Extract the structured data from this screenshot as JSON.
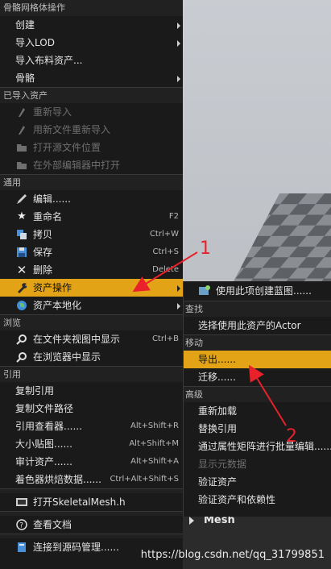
{
  "main_menu": {
    "sections": [
      {
        "header": "骨骼网格体操作",
        "items": [
          {
            "label": "创建",
            "submenu": true
          },
          {
            "label": "导入LOD",
            "submenu": true
          },
          {
            "label": "导入布料资产...",
            "submenu": false
          },
          {
            "label": "骨骼",
            "submenu": true
          }
        ]
      },
      {
        "header": "已导入资产",
        "items": [
          {
            "label": "重新导入",
            "icon": "reimport-icon",
            "disabled": true
          },
          {
            "label": "用新文件重新导入",
            "icon": "reimport-new-file-icon",
            "disabled": true
          },
          {
            "label": "打开源文件位置",
            "icon": "folder-icon",
            "disabled": true
          },
          {
            "label": "在外部编辑器中打开",
            "icon": "external-editor-icon",
            "disabled": true
          }
        ]
      },
      {
        "header": "通用",
        "items": [
          {
            "label": "编辑......",
            "icon": "edit-icon"
          },
          {
            "label": "重命名",
            "icon": "rename-icon",
            "shortcut": "F2"
          },
          {
            "label": "拷贝",
            "icon": "duplicate-icon",
            "shortcut": "Ctrl+W"
          },
          {
            "label": "保存",
            "icon": "save-icon",
            "shortcut": "Ctrl+S"
          },
          {
            "label": "删除",
            "icon": "delete-icon",
            "shortcut": "Delete"
          },
          {
            "label": "资产操作",
            "icon": "wrench-icon",
            "submenu": true,
            "highlighted": true
          },
          {
            "label": "资产本地化",
            "icon": "globe-icon",
            "submenu": true
          }
        ]
      },
      {
        "header": "浏览",
        "items": [
          {
            "label": "在文件夹视图中显示",
            "icon": "magnifier-icon",
            "shortcut": "Ctrl+B"
          },
          {
            "label": "在浏览器中显示",
            "icon": "magnifier-icon"
          }
        ]
      },
      {
        "header": "引用",
        "items": [
          {
            "label": "复制引用"
          },
          {
            "label": "复制文件路径"
          },
          {
            "label": "引用查看器......",
            "shortcut": "Alt+Shift+R"
          },
          {
            "label": "大小贴图......",
            "shortcut": "Alt+Shift+M"
          },
          {
            "label": "审计资产......",
            "shortcut": "Alt+Shift+A"
          },
          {
            "label": "着色器烘焙数据......",
            "shortcut": "Ctrl+Alt+Shift+S"
          }
        ]
      },
      {
        "items": [
          {
            "label": "打开SkeletalMesh.h",
            "icon": "code-icon"
          }
        ]
      },
      {
        "items": [
          {
            "label": "查看文档",
            "icon": "help-icon"
          }
        ]
      },
      {
        "items": [
          {
            "label": "连接到源码管理......",
            "icon": "source-control-icon"
          }
        ]
      }
    ]
  },
  "submenu": {
    "top_item": {
      "label": "使用此项创建蓝图......",
      "icon": "blueprint-icon"
    },
    "sections": [
      {
        "header": "查找",
        "items": [
          {
            "label": "选择使用此资产的Actor"
          }
        ]
      },
      {
        "header": "移动",
        "items": [
          {
            "label": "导出......",
            "highlighted": true
          },
          {
            "label": "迁移......"
          }
        ]
      },
      {
        "header": "高级",
        "items": [
          {
            "label": "重新加载"
          },
          {
            "label": "替换引用"
          },
          {
            "label": "通过属性矩阵进行批量编辑......"
          },
          {
            "label": "显示元数据",
            "disabled": true
          },
          {
            "label": "验证资产"
          },
          {
            "label": "验证资产和依赖性"
          }
        ]
      }
    ]
  },
  "viewport": {
    "bottom_label": "Mesh"
  },
  "annotations": {
    "label_1": "1",
    "label_2": "2",
    "arrow_color": "#e8212b"
  },
  "watermark": "https://blog.csdn.net/qq_31799851",
  "colors": {
    "highlight": "#e2a416",
    "menu_bg": "#1a1a1a"
  }
}
